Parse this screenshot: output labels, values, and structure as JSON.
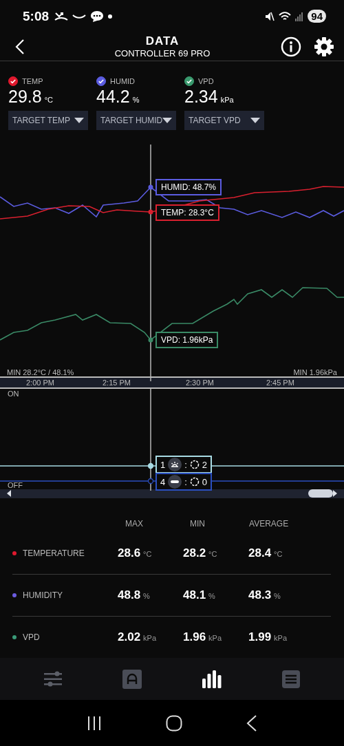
{
  "status_bar": {
    "time": "5:08",
    "battery": "94"
  },
  "header": {
    "title": "DATA",
    "subtitle": "CONTROLLER 69 PRO"
  },
  "sensors": [
    {
      "label": "TEMP",
      "checked": true,
      "color": "#e0192e",
      "value": "29.8",
      "unit": "°C",
      "target": "TARGET TEMP"
    },
    {
      "label": "HUMID",
      "checked": true,
      "color": "#5b5ce0",
      "value": "44.2",
      "unit": "%",
      "target": "TARGET HUMID"
    },
    {
      "label": "VPD",
      "checked": true,
      "color": "#3a9a6e",
      "value": "2.34",
      "unit": "kPa",
      "target": "TARGET VPD"
    }
  ],
  "chart": {
    "tooltips": [
      {
        "text": "HUMID: 48.7%",
        "color": "#5b5ce0"
      },
      {
        "text": "TEMP: 28.3°C",
        "color": "#d9202f"
      },
      {
        "text": "VPD: 1.96kPa",
        "color": "#3a8a66"
      }
    ],
    "min_left": "MIN 28.2°C / 48.1%",
    "min_right": "MIN 1.96kPa",
    "x_labels": [
      "2:00 PM",
      "2:15 PM",
      "2:30 PM",
      "2:45 PM"
    ]
  },
  "devices": {
    "on_label": "ON",
    "off_label": "OFF",
    "rows": [
      {
        "port": "1",
        "kind": "light",
        "separator": ":",
        "level_text": "2",
        "color": "#a8dbe4"
      },
      {
        "port": "4",
        "kind": "plug",
        "separator": ":",
        "level_text": "0",
        "color": "#2b4fc0"
      }
    ]
  },
  "stats": {
    "columns": [
      "MAX",
      "MIN",
      "AVERAGE"
    ],
    "rows": [
      {
        "name": "TEMPERATURE",
        "color": "#e0192e",
        "values": [
          {
            "value": "28.6",
            "unit": "°C"
          },
          {
            "value": "28.2",
            "unit": "°C"
          },
          {
            "value": "28.4",
            "unit": "°C"
          }
        ]
      },
      {
        "name": "HUMIDITY",
        "color": "#6b5ce0",
        "values": [
          {
            "value": "48.8",
            "unit": "%"
          },
          {
            "value": "48.1",
            "unit": "%"
          },
          {
            "value": "48.3",
            "unit": "%"
          }
        ]
      },
      {
        "name": "VPD",
        "color": "#3a9a78",
        "values": [
          {
            "value": "2.02",
            "unit": "kPa"
          },
          {
            "value": "1.96",
            "unit": "kPa"
          },
          {
            "value": "1.99",
            "unit": "kPa"
          }
        ]
      }
    ]
  },
  "nav": [
    {
      "kind": "sliders",
      "selected": false
    },
    {
      "kind": "a-box",
      "selected": false
    },
    {
      "kind": "bars",
      "selected": true
    },
    {
      "kind": "list",
      "selected": false
    }
  ]
}
